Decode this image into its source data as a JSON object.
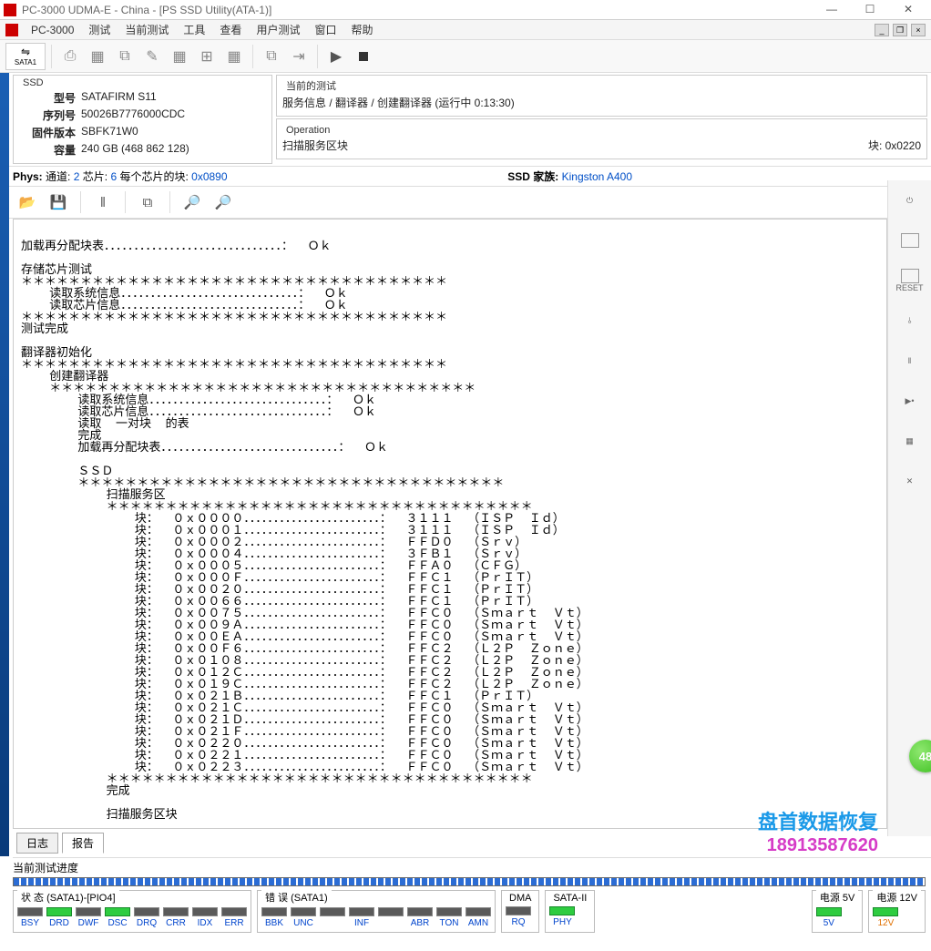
{
  "window": {
    "title": "PC-3000 UDMA-E - China - [PS SSD Utility(ATA-1)]"
  },
  "menu": {
    "app": "PC-3000",
    "items": [
      "测试",
      "当前测试",
      "工具",
      "查看",
      "用户测试",
      "窗口",
      "帮助"
    ]
  },
  "toolbar": {
    "sata": "SATA1"
  },
  "info": {
    "ssd_legend": "SSD",
    "model_label": "型号",
    "model": "SATAFIRM   S11",
    "serial_label": "序列号",
    "serial": "50026B7776000CDC",
    "fw_label": "固件版本",
    "fw": "SBFK71W0",
    "cap_label": "容量",
    "cap": "240 GB (468 862 128)",
    "current_legend": "当前的测试",
    "current_line": "服务信息 / 翻译器 / 创建翻译器 (运行中 0:13:30)",
    "op_legend": "Operation",
    "op_left": "扫描服务区块",
    "op_right": "块: 0x0220"
  },
  "phys": {
    "label": "Phys:",
    "ch_label": "通道:",
    "ch": "2",
    "chip_label": "芯片:",
    "chip": "6",
    "perchip_label": "每个芯片的块:",
    "perchip": "0x0890",
    "fam_label": "SSD 家族:",
    "fam": "Kingston A400"
  },
  "log": {
    "lines": [
      "",
      "加载再分配块表．．．．．．．．．．．．．．．．．．．．．．．．．．．．．．：  Ｏｋ",
      "",
      "存储芯片测试",
      "＊＊＊＊＊＊＊＊＊＊＊＊＊＊＊＊＊＊＊＊＊＊＊＊＊＊＊＊＊＊＊＊＊＊＊＊",
      "    读取系统信息．．．．．．．．．．．．．．．．．．．．．．．．．．．．．．：  Ｏｋ",
      "    读取芯片信息．．．．．．．．．．．．．．．．．．．．．．．．．．．．．．：  Ｏｋ",
      "＊＊＊＊＊＊＊＊＊＊＊＊＊＊＊＊＊＊＊＊＊＊＊＊＊＊＊＊＊＊＊＊＊＊＊＊",
      "测试完成",
      "",
      "翻译器初始化",
      "＊＊＊＊＊＊＊＊＊＊＊＊＊＊＊＊＊＊＊＊＊＊＊＊＊＊＊＊＊＊＊＊＊＊＊＊",
      "    创建翻译器",
      "    ＊＊＊＊＊＊＊＊＊＊＊＊＊＊＊＊＊＊＊＊＊＊＊＊＊＊＊＊＊＊＊＊＊＊＊＊",
      "        读取系统信息．．．．．．．．．．．．．．．．．．．．．．．．．．．．．．：  Ｏｋ",
      "        读取芯片信息．．．．．．．．．．．．．．．．．．．．．．．．．．．．．．：  Ｏｋ",
      "        读取  一对块  的表",
      "        完成",
      "        加载再分配块表．．．．．．．．．．．．．．．．．．．．．．．．．．．．．．：  Ｏｋ",
      "",
      "        ＳＳＤ",
      "        ＊＊＊＊＊＊＊＊＊＊＊＊＊＊＊＊＊＊＊＊＊＊＊＊＊＊＊＊＊＊＊＊＊＊＊＊",
      "            扫描服务区",
      "            ＊＊＊＊＊＊＊＊＊＊＊＊＊＊＊＊＊＊＊＊＊＊＊＊＊＊＊＊＊＊＊＊＊＊＊＊",
      "                块：  ０ｘ００００．．．．．．．．．．．．．．．．．．．．．．．：  ３１１１  （ＩＳＰ  Ｉｄ）",
      "                块：  ０ｘ０００１．．．．．．．．．．．．．．．．．．．．．．．：  ３１１１  （ＩＳＰ  Ｉｄ）",
      "                块：  ０ｘ０００２．．．．．．．．．．．．．．．．．．．．．．．：  ＦＦＤ０  （Ｓｒｖ）",
      "                块：  ０ｘ０００４．．．．．．．．．．．．．．．．．．．．．．．：  ３ＦＢ１  （Ｓｒｖ）",
      "                块：  ０ｘ０００５．．．．．．．．．．．．．．．．．．．．．．．：  ＦＦＡ０  （ＣＦＧ）",
      "                块：  ０ｘ０００Ｆ．．．．．．．．．．．．．．．．．．．．．．．：  ＦＦＣ１  （ＰｒＩＴ）",
      "                块：  ０ｘ００２０．．．．．．．．．．．．．．．．．．．．．．．：  ＦＦＣ１  （ＰｒＩＴ）",
      "                块：  ０ｘ００６６．．．．．．．．．．．．．．．．．．．．．．．：  ＦＦＣ１  （ＰｒＩＴ）",
      "                块：  ０ｘ００７５．．．．．．．．．．．．．．．．．．．．．．．：  ＦＦＣ０  （Ｓｍａｒｔ  Ｖｔ）",
      "                块：  ０ｘ００９Ａ．．．．．．．．．．．．．．．．．．．．．．．：  ＦＦＣ０  （Ｓｍａｒｔ  Ｖｔ）",
      "                块：  ０ｘ００ＥＡ．．．．．．．．．．．．．．．．．．．．．．．：  ＦＦＣ０  （Ｓｍａｒｔ  Ｖｔ）",
      "                块：  ０ｘ００Ｆ６．．．．．．．．．．．．．．．．．．．．．．．：  ＦＦＣ２  （Ｌ２Ｐ  Ｚｏｎｅ）",
      "                块：  ０ｘ０１０８．．．．．．．．．．．．．．．．．．．．．．．：  ＦＦＣ２  （Ｌ２Ｐ  Ｚｏｎｅ）",
      "                块：  ０ｘ０１２Ｃ．．．．．．．．．．．．．．．．．．．．．．．：  ＦＦＣ２  （Ｌ２Ｐ  Ｚｏｎｅ）",
      "                块：  ０ｘ０１９Ｃ．．．．．．．．．．．．．．．．．．．．．．．：  ＦＦＣ２  （Ｌ２Ｐ  Ｚｏｎｅ）",
      "                块：  ０ｘ０２１Ｂ．．．．．．．．．．．．．．．．．．．．．．．：  ＦＦＣ１  （ＰｒＩＴ）",
      "                块：  ０ｘ０２１Ｃ．．．．．．．．．．．．．．．．．．．．．．．：  ＦＦＣ０  （Ｓｍａｒｔ  Ｖｔ）",
      "                块：  ０ｘ０２１Ｄ．．．．．．．．．．．．．．．．．．．．．．．：  ＦＦＣ０  （Ｓｍａｒｔ  Ｖｔ）",
      "                块：  ０ｘ０２１Ｆ．．．．．．．．．．．．．．．．．．．．．．．：  ＦＦＣ０  （Ｓｍａｒｔ  Ｖｔ）",
      "                块：  ０ｘ０２２０．．．．．．．．．．．．．．．．．．．．．．．：  ＦＦＣ０  （Ｓｍａｒｔ  Ｖｔ）",
      "                块：  ０ｘ０２２１．．．．．．．．．．．．．．．．．．．．．．．：  ＦＦＣ０  （Ｓｍａｒｔ  Ｖｔ）",
      "                块：  ０ｘ０２２３．．．．．．．．．．．．．．．．．．．．．．．：  ＦＦＣ０  （Ｓｍａｒｔ  Ｖｔ）",
      "            ＊＊＊＊＊＊＊＊＊＊＊＊＊＊＊＊＊＊＊＊＊＊＊＊＊＊＊＊＊＊＊＊＊＊＊＊",
      "            完成",
      "",
      "            扫描服务区块"
    ]
  },
  "tabs": {
    "log": "日志",
    "report": "报告"
  },
  "progress": {
    "label": "当前测试进度"
  },
  "status": {
    "state_legend": "状 态 (SATA1)-[PIO4]",
    "state_items": [
      {
        "label": "BSY",
        "on": false
      },
      {
        "label": "DRD",
        "on": true
      },
      {
        "label": "DWF",
        "on": false
      },
      {
        "label": "DSC",
        "on": true
      },
      {
        "label": "DRQ",
        "on": false
      },
      {
        "label": "CRR",
        "on": false
      },
      {
        "label": "IDX",
        "on": false
      },
      {
        "label": "ERR",
        "on": false
      }
    ],
    "err_legend": "错 误 (SATA1)",
    "err_items": [
      {
        "label": "BBK"
      },
      {
        "label": "UNC"
      },
      {
        "label": ""
      },
      {
        "label": "INF"
      },
      {
        "label": ""
      },
      {
        "label": "ABR"
      },
      {
        "label": "TON"
      },
      {
        "label": "AMN"
      }
    ],
    "dma_legend": "DMA",
    "dma_item": {
      "label": "RQ"
    },
    "sata2_legend": "SATA-II",
    "sata2_item": {
      "label": "PHY",
      "on": true
    },
    "p5_legend": "电源 5V",
    "p5_item": {
      "label": "5V",
      "on": true
    },
    "p12_legend": "电源 12V",
    "p12_item": {
      "label": "12V",
      "on": true
    }
  },
  "right": {
    "reset": "RESET",
    "badge": "48"
  },
  "watermark": {
    "l1": "盘首数据恢复",
    "l2": "18913587620"
  }
}
